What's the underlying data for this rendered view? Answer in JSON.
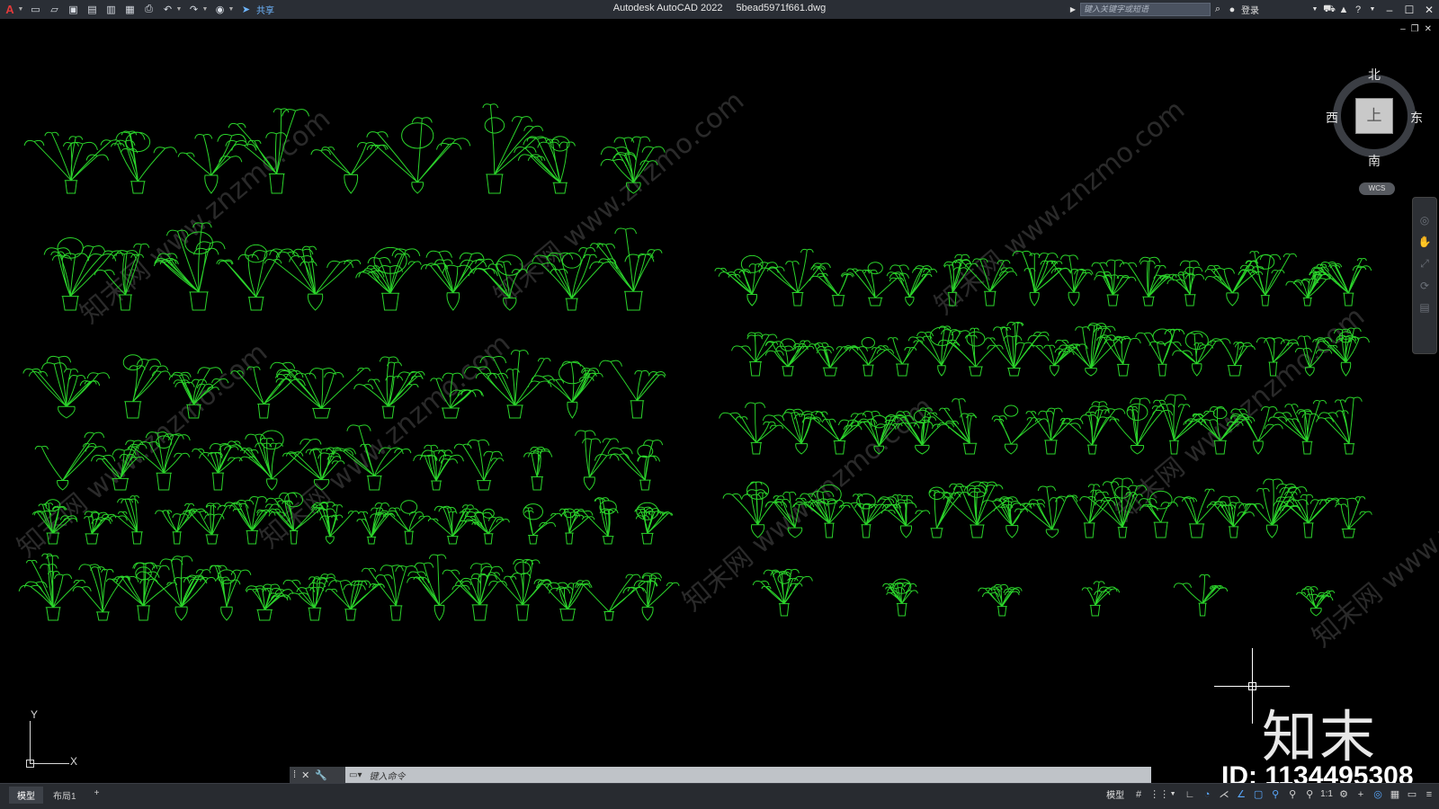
{
  "titlebar": {
    "app_name": "Autodesk AutoCAD 2022",
    "file_name": "5bead5971f661.dwg",
    "share_label": "共享",
    "search_placeholder": "键入关键字或短语",
    "login_label": "登录",
    "quick_access_icons": [
      "new-icon",
      "open-icon",
      "save-icon",
      "saveas-icon",
      "web-open-icon",
      "web-save-icon",
      "print-icon",
      "undo-icon",
      "redo-icon",
      "share-icon"
    ]
  },
  "viewcube": {
    "north": "北",
    "south": "南",
    "east": "东",
    "west": "西",
    "face": "上",
    "wcs": "WCS"
  },
  "ucs": {
    "x_label": "X",
    "y_label": "Y"
  },
  "watermark": {
    "brand": "知末",
    "id_text": "ID: 1134495308",
    "diagonal_text": "知末网 www.znzmo.com"
  },
  "command_line": {
    "placeholder": "键入命令"
  },
  "layout_tabs": [
    {
      "label": "模型",
      "active": true
    },
    {
      "label": "布局1",
      "active": false
    }
  ],
  "add_tab_label": "+",
  "status_bar": {
    "model_label": "模型",
    "scale_label": "1:1"
  },
  "colors": {
    "canvas_bg": "#000000",
    "plant_stroke": "#2bd42b",
    "titlebar_bg": "#2a2e35",
    "accent_blue": "#5aa9ff"
  },
  "drawing": {
    "content": "plant elevation symbols (potted plants, bonsai, vases)",
    "plant_groups": [
      {
        "name": "left-group",
        "rows": [
          9,
          10,
          10,
          12,
          16,
          15
        ]
      },
      {
        "name": "right-group",
        "rows": [
          16,
          17,
          15,
          17,
          6
        ]
      }
    ]
  }
}
